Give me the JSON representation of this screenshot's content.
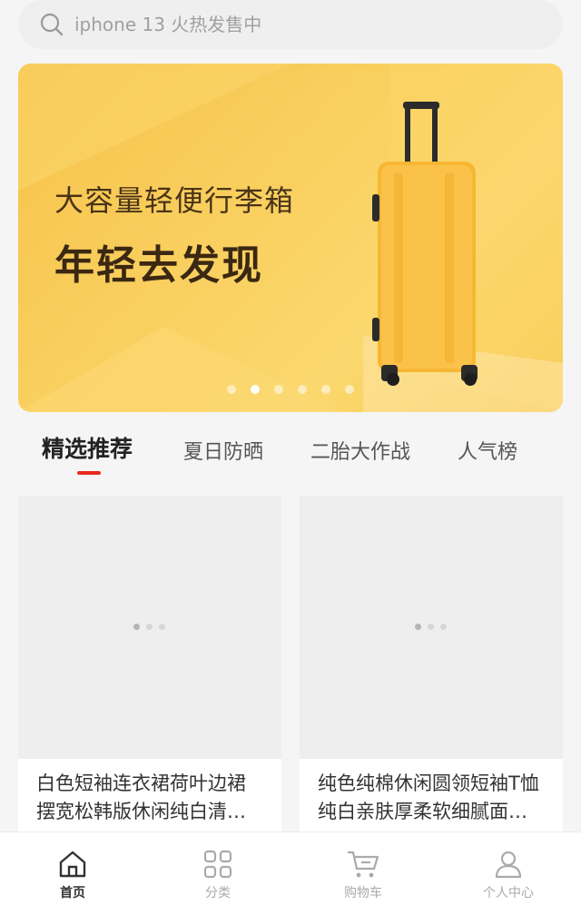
{
  "search": {
    "placeholder": "iphone 13 火热发售中"
  },
  "banner": {
    "line1": "大容量轻便行李箱",
    "line2": "年轻去发现",
    "dot_count": 6,
    "active_dot": 1
  },
  "tabs": [
    {
      "label": "精选推荐",
      "active": true
    },
    {
      "label": "夏日防晒",
      "active": false
    },
    {
      "label": "二胎大作战",
      "active": false
    },
    {
      "label": "人气榜",
      "active": false
    }
  ],
  "products": [
    {
      "title": "白色短袖连衣裙荷叶边裙摆宽松韩版休闲纯白清爽优雅连衣裙"
    },
    {
      "title": "纯色纯棉休闲圆领短袖T恤纯白亲肤厚柔软细腻面料纯白短袖套头T恤"
    }
  ],
  "tabbar": [
    {
      "label": "首页",
      "icon": "home-icon",
      "active": true
    },
    {
      "label": "分类",
      "icon": "grid-icon",
      "active": false
    },
    {
      "label": "购物车",
      "icon": "cart-icon",
      "active": false
    },
    {
      "label": "个人中心",
      "icon": "user-icon",
      "active": false
    }
  ],
  "colors": {
    "accent": "#e8281e",
    "banner": "#f9cf5e"
  }
}
